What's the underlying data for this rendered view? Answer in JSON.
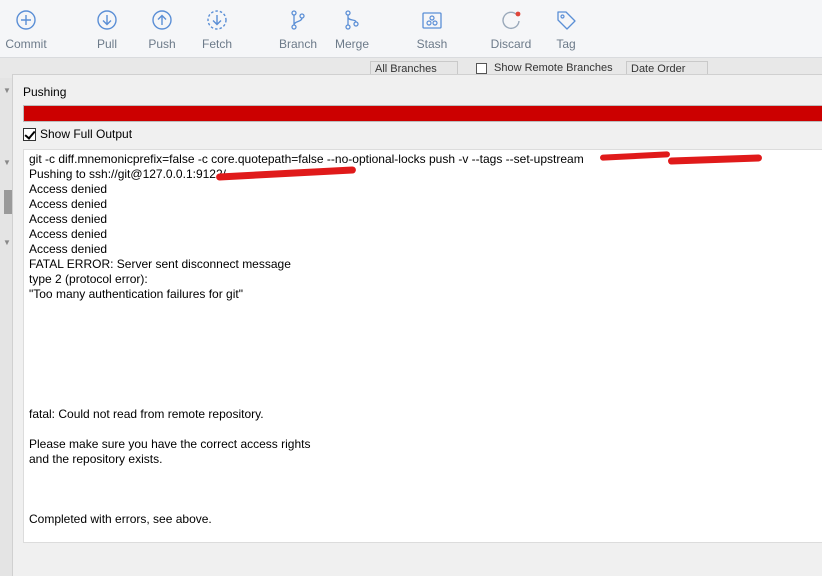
{
  "toolbar": {
    "commit": "Commit",
    "pull": "Pull",
    "push": "Push",
    "fetch": "Fetch",
    "branch": "Branch",
    "merge": "Merge",
    "stash": "Stash",
    "discard": "Discard",
    "tag": "Tag"
  },
  "background": {
    "branches_filter": "All Branches",
    "show_remote": "Show Remote Branches",
    "order": "Date Order"
  },
  "dialog": {
    "title": "Pushing",
    "progress": 1.0,
    "progress_color": "#cc0000",
    "show_full_output": "Show Full Output",
    "output_lines": [
      "git -c diff.mnemonicprefix=false -c core.quotepath=false --no-optional-locks push -v --tags --set-upstream",
      "Pushing to ssh://git@127.0.0.1:9122/",
      "Access denied",
      "Access denied",
      "Access denied",
      "Access denied",
      "Access denied",
      "FATAL ERROR: Server sent disconnect message",
      "type 2 (protocol error):",
      "\"Too many authentication failures for git\"",
      "",
      "",
      "",
      "",
      "",
      "",
      "",
      "fatal: Could not read from remote repository.",
      "",
      "Please make sure you have the correct access rights",
      "and the repository exists.",
      "",
      "",
      "",
      "Completed with errors, see above."
    ]
  },
  "colors": {
    "accent_icon": "#5b8fd6",
    "discard_dot": "#e0463a",
    "redaction": "#e01a1a"
  }
}
